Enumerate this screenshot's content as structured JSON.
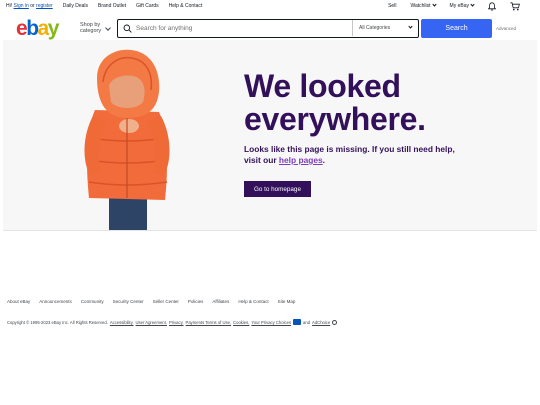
{
  "topbar": {
    "greeting": "Hi!",
    "sign_in": "Sign in",
    "or": "or",
    "register": "register",
    "links": [
      "Daily Deals",
      "Brand Outlet",
      "Gift Cards",
      "Help & Contact"
    ],
    "sell": "Sell",
    "watchlist": "Watchlist",
    "my_ebay": "My eBay"
  },
  "header": {
    "logo": {
      "e": "e",
      "b": "b",
      "a": "a",
      "y": "y"
    },
    "shop_by_line1": "Shop by",
    "shop_by_line2": "category",
    "search_placeholder": "Search for anything",
    "category_selected": "All Categories",
    "search_button": "Search",
    "advanced": "Advanced"
  },
  "hero": {
    "headline_line1": "We looked",
    "headline_line2": "everywhere.",
    "sub_line1": "Looks like this page is missing. If you still need help,",
    "sub_line2_pre": "visit our ",
    "sub_link": "help pages",
    "sub_line2_post": ".",
    "cta": "Go to homepage"
  },
  "footer": {
    "links": [
      "About eBay",
      "Announcements",
      "Community",
      "Security Center",
      "Seller Center",
      "Policies",
      "Affiliates",
      "Help & Contact",
      "Site Map"
    ],
    "copyright": "Copyright © 1995-2023 eBay Inc. All Rights Reserved.",
    "legal_links": [
      "Accessibility,",
      "User Agreement,",
      "Privacy,",
      "Payments Terms of Use,",
      "Cookies,",
      "Your Privacy Choices"
    ],
    "and": "and",
    "adchoice": "AdChoice"
  },
  "colors": {
    "primary_blue": "#3665f3",
    "hero_purple": "#33105a",
    "link_purple": "#7d3bbf",
    "jacket_orange": "#f26b3a"
  }
}
